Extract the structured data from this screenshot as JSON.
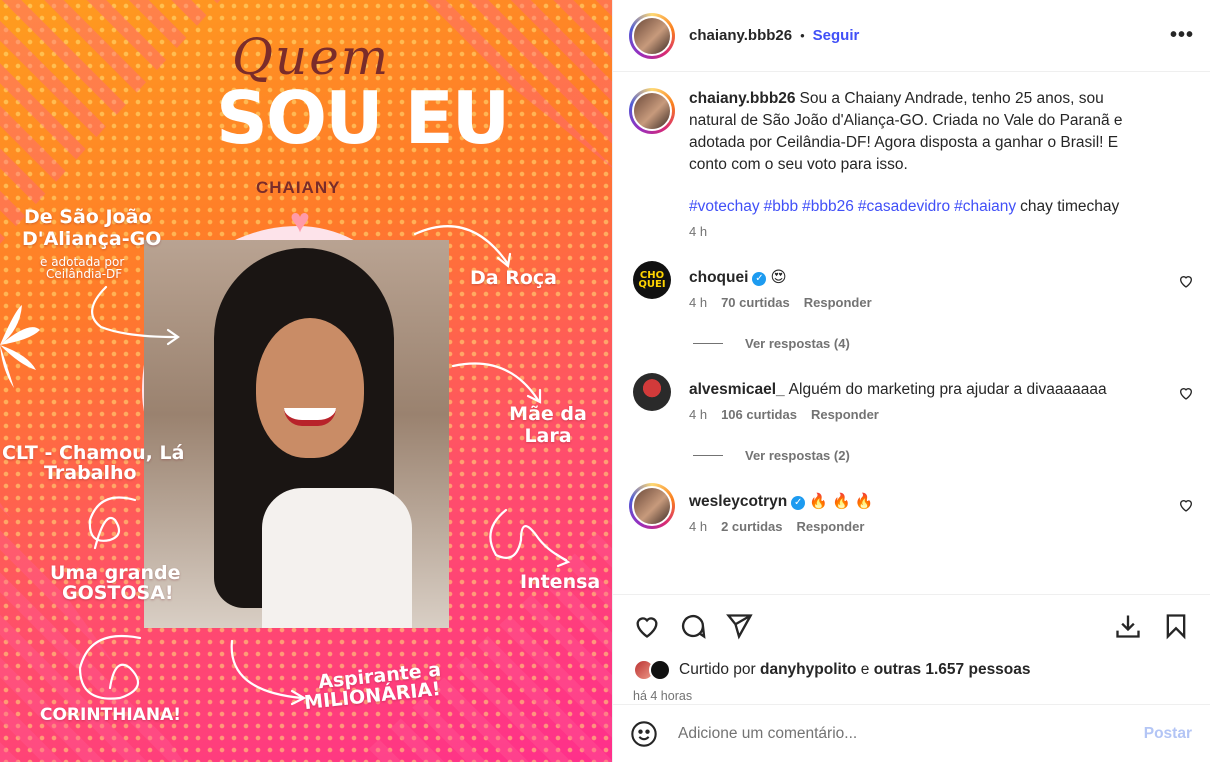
{
  "image": {
    "title_script": "Quem",
    "title_main": "SOU EU",
    "name": "CHAIANY",
    "labels": {
      "origin_line1": "De São João",
      "origin_line2": "D'Aliança-GO",
      "origin_small1": "e adotada por",
      "origin_small2": "Ceilândia-DF",
      "roca": "Da Roça",
      "mae": "Mãe da Lara",
      "clt1": "CLT - Chamou, Lá",
      "clt2": "Trabalho",
      "gostosa1": "Uma grande",
      "gostosa2": "GOSTOSA!",
      "intensa": "Intensa",
      "corinthiana": "CORINTHIANA!",
      "aspirante1": "Aspirante a",
      "aspirante2": "MILIONÁRIA!"
    }
  },
  "header": {
    "username": "chaiany.bbb26",
    "dot": "•",
    "follow": "Seguir",
    "more": "•••"
  },
  "caption": {
    "username": "chaiany.bbb26",
    "text": "Sou a Chaiany Andrade, tenho 25 anos, sou natural de São João d'Aliança-GO. Criada no Vale do Paranã e adotada por Ceilândia-DF! Agora disposta a ganhar o Brasil! E conto com o seu voto para isso.",
    "tags": [
      "#votechay",
      "#bbb",
      "#bbb26",
      "#casadevidro",
      "#chaiany"
    ],
    "tail": "chay timechay",
    "time": "4 h"
  },
  "comments": [
    {
      "username": "choquei",
      "verified": true,
      "text": "😍",
      "time": "4 h",
      "likes": "70 curtidas",
      "reply": "Responder",
      "replies": "Ver respostas (4)",
      "avatar_text": "CHO QUEI"
    },
    {
      "username": "alvesmicael_",
      "verified": false,
      "text": "Alguém do marketing pra ajudar a divaaaaaaa",
      "time": "4 h",
      "likes": "106 curtidas",
      "reply": "Responder",
      "replies": "Ver respostas (2)"
    },
    {
      "username": "wesleycotryn",
      "verified": true,
      "text": "🔥 🔥 🔥",
      "time": "4 h",
      "likes": "2 curtidas",
      "reply": "Responder"
    }
  ],
  "likes": {
    "prefix": "Curtido por",
    "user": "danyhypolito",
    "and": "e",
    "others": "outras 1.657 pessoas",
    "time_ago": "há 4 horas"
  },
  "add_comment": {
    "placeholder": "Adicione um comentário...",
    "post": "Postar"
  }
}
